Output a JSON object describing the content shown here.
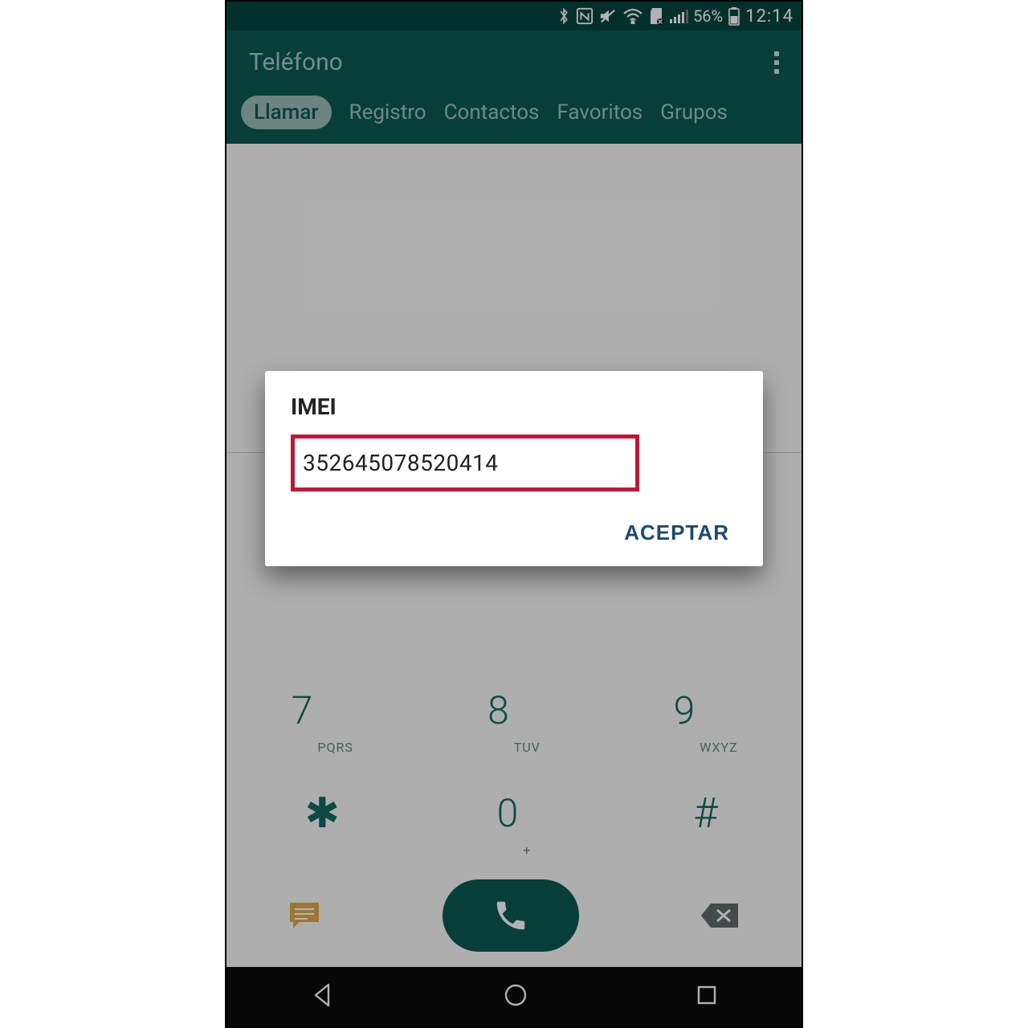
{
  "status": {
    "battery_pct": "56%",
    "time": "12:14"
  },
  "header": {
    "title": "Teléfono"
  },
  "tabs": {
    "call": "Llamar",
    "log": "Registro",
    "contacts": "Contactos",
    "favorites": "Favoritos",
    "groups": "Grupos"
  },
  "dialpad": {
    "k7": {
      "digit": "7",
      "letters": "PQRS"
    },
    "k8": {
      "digit": "8",
      "letters": "TUV"
    },
    "k9": {
      "digit": "9",
      "letters": "WXYZ"
    },
    "star": "✱",
    "k0": {
      "digit": "0",
      "letters": "+"
    },
    "hash": "#"
  },
  "dialog": {
    "title": "IMEI",
    "imei": "352645078520414",
    "accept": "ACEPTAR"
  }
}
